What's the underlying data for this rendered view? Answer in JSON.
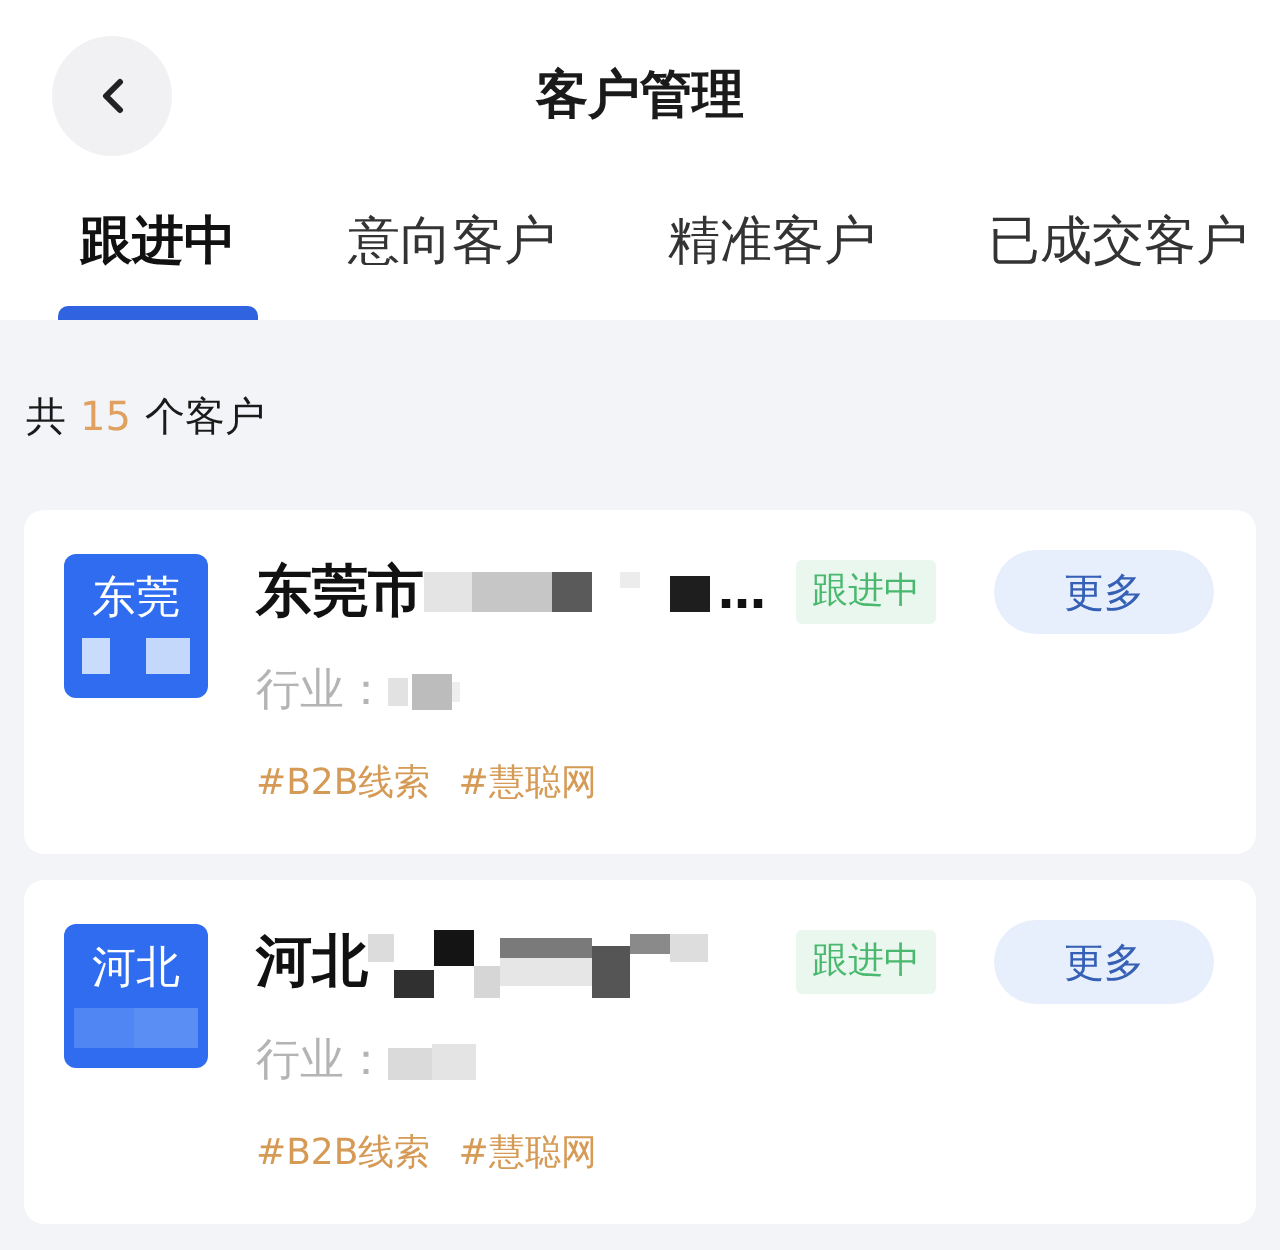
{
  "header": {
    "title": "客户管理"
  },
  "tabs": [
    {
      "label": "跟进中",
      "selected": true
    },
    {
      "label": "意向客户",
      "selected": false
    },
    {
      "label": "精准客户",
      "selected": false
    },
    {
      "label": "已成交客户",
      "selected": false
    }
  ],
  "summary": {
    "prefix": "共",
    "count": "15",
    "suffix": "个客户"
  },
  "customers": [
    {
      "avatar_text": "东莞",
      "name": "东莞市",
      "name_tail": "…",
      "industry_label": "行业：",
      "tags": [
        "#B2B线索",
        "#慧聪网"
      ],
      "status": "跟进中",
      "action": "更多"
    },
    {
      "avatar_text": "河北",
      "name": "河北",
      "industry_label": "行业：",
      "tags": [
        "#B2B线索",
        "#慧聪网"
      ],
      "status": "跟进中",
      "action": "更多"
    }
  ]
}
